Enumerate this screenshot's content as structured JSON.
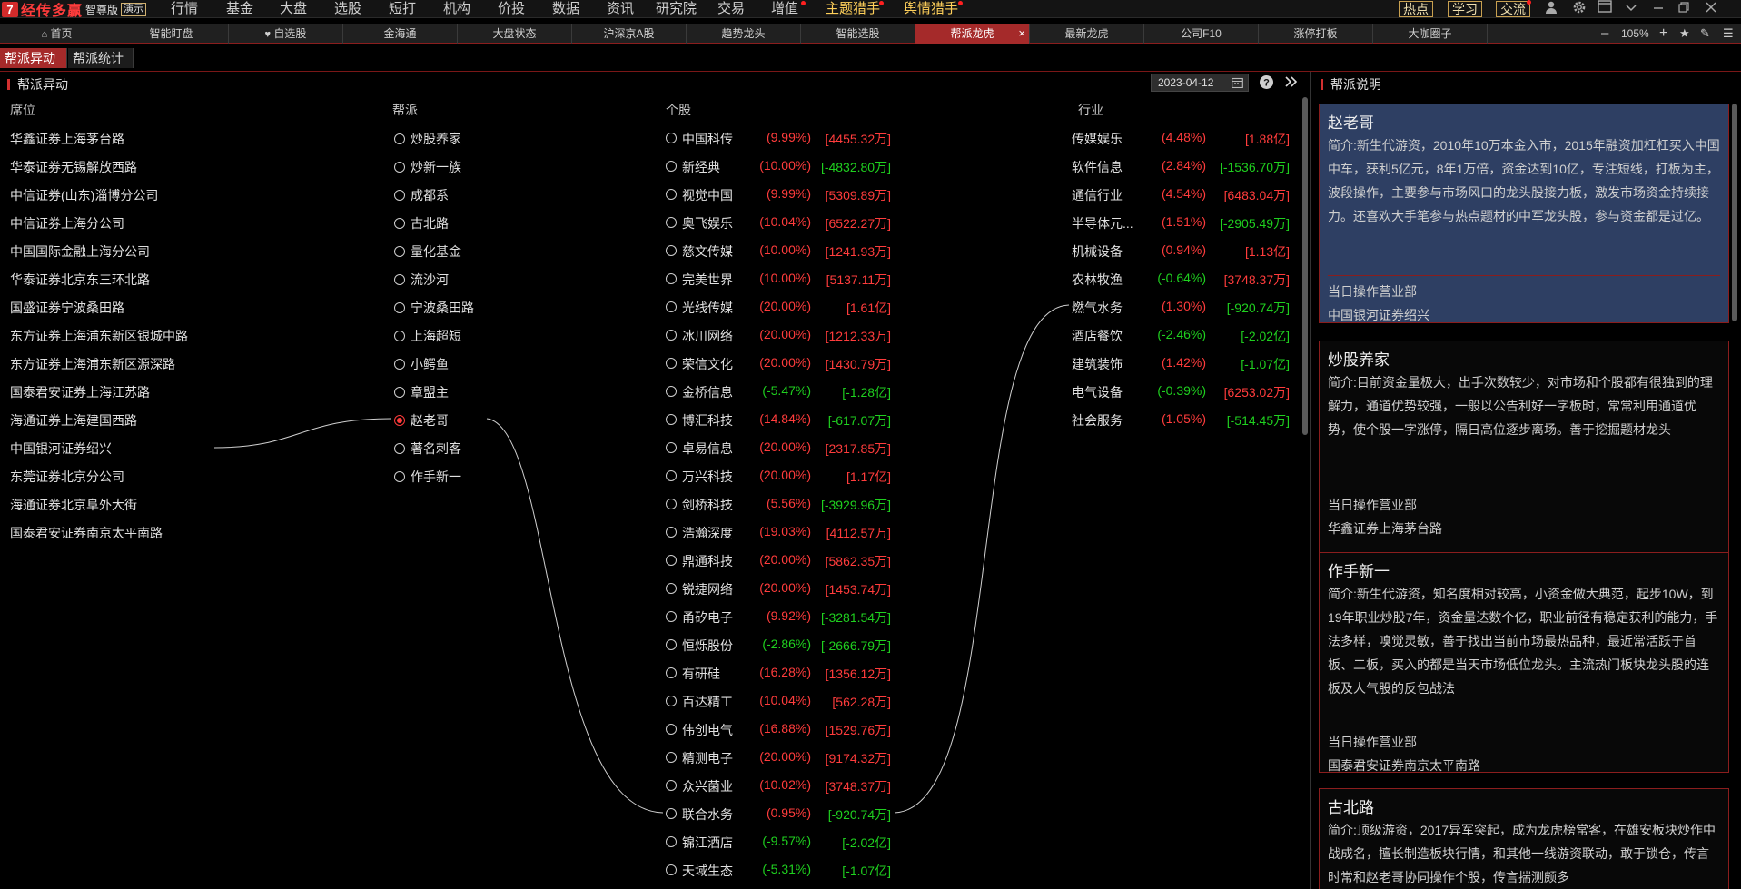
{
  "app": {
    "logo_mark": "7",
    "name": "经传多赢",
    "edition": "智尊版",
    "demo": "演示"
  },
  "menu": [
    "行情",
    "基金",
    "大盘",
    "选股",
    "短打",
    "机构",
    "价投",
    "数据",
    "资讯",
    "研究院",
    "交易",
    "增值",
    "主题猎手",
    "舆情猎手"
  ],
  "top_buttons": [
    "热点",
    "学习",
    "交流"
  ],
  "tabs": [
    "首页",
    "智能盯盘",
    "自选股",
    "金海通",
    "大盘状态",
    "沪深京A股",
    "趋势龙头",
    "智能选股",
    "帮派龙虎",
    "最新龙虎",
    "公司F10",
    "涨停打板",
    "大咖圈子"
  ],
  "tab_close": "×",
  "zoom": "105%",
  "subtabs": [
    "帮派异动",
    "帮派统计"
  ],
  "left_title": "帮派异动",
  "date": "2023-04-12",
  "right_title": "帮派说明",
  "headers": {
    "seat": "席位",
    "gang": "帮派",
    "stock": "个股",
    "industry": "行业"
  },
  "seats": [
    "华鑫证券上海茅台路",
    "华泰证券无锡解放西路",
    "中信证券(山东)淄博分公司",
    "中信证券上海分公司",
    "中国国际金融上海分公司",
    "华泰证券北京东三环北路",
    "国盛证券宁波桑田路",
    "东方证券上海浦东新区银城中路",
    "东方证券上海浦东新区源深路",
    "国泰君安证券上海江苏路",
    "海通证券上海建国西路",
    "中国银河证券绍兴",
    "东莞证券北京分公司",
    "海通证券北京阜外大街",
    "国泰君安证券南京太平南路"
  ],
  "gangs": [
    "炒股养家",
    "炒新一族",
    "成都系",
    "古北路",
    "量化基金",
    "流沙河",
    "宁波桑田路",
    "上海超短",
    "小鳄鱼",
    "章盟主",
    "赵老哥",
    "著名刺客",
    "作手新一"
  ],
  "selected_gang": "赵老哥",
  "stocks": [
    {
      "name": "中国科传",
      "pct": "(9.99%)",
      "amt": "[4455.32万]",
      "pc": "red",
      "ac": "red"
    },
    {
      "name": "新经典",
      "pct": "(10.00%)",
      "amt": "[-4832.80万]",
      "pc": "red",
      "ac": "green"
    },
    {
      "name": "视觉中国",
      "pct": "(9.99%)",
      "amt": "[5309.89万]",
      "pc": "red",
      "ac": "red"
    },
    {
      "name": "奥飞娱乐",
      "pct": "(10.04%)",
      "amt": "[6522.27万]",
      "pc": "red",
      "ac": "red"
    },
    {
      "name": "慈文传媒",
      "pct": "(10.00%)",
      "amt": "[1241.93万]",
      "pc": "red",
      "ac": "red"
    },
    {
      "name": "完美世界",
      "pct": "(10.00%)",
      "amt": "[5137.11万]",
      "pc": "red",
      "ac": "red"
    },
    {
      "name": "光线传媒",
      "pct": "(20.00%)",
      "amt": "[1.61亿]",
      "pc": "red",
      "ac": "red"
    },
    {
      "name": "冰川网络",
      "pct": "(20.00%)",
      "amt": "[1212.33万]",
      "pc": "red",
      "ac": "red"
    },
    {
      "name": "荣信文化",
      "pct": "(20.00%)",
      "amt": "[1430.79万]",
      "pc": "red",
      "ac": "red"
    },
    {
      "name": "金桥信息",
      "pct": "(-5.47%)",
      "amt": "[-1.28亿]",
      "pc": "green",
      "ac": "green"
    },
    {
      "name": "博汇科技",
      "pct": "(14.84%)",
      "amt": "[-617.07万]",
      "pc": "red",
      "ac": "green"
    },
    {
      "name": "卓易信息",
      "pct": "(20.00%)",
      "amt": "[2317.85万]",
      "pc": "red",
      "ac": "red"
    },
    {
      "name": "万兴科技",
      "pct": "(20.00%)",
      "amt": "[1.17亿]",
      "pc": "red",
      "ac": "red"
    },
    {
      "name": "剑桥科技",
      "pct": "(5.56%)",
      "amt": "[-3929.96万]",
      "pc": "red",
      "ac": "green"
    },
    {
      "name": "浩瀚深度",
      "pct": "(19.03%)",
      "amt": "[4112.57万]",
      "pc": "red",
      "ac": "red"
    },
    {
      "name": "鼎通科技",
      "pct": "(20.00%)",
      "amt": "[5862.35万]",
      "pc": "red",
      "ac": "red"
    },
    {
      "name": "锐捷网络",
      "pct": "(20.00%)",
      "amt": "[1453.74万]",
      "pc": "red",
      "ac": "red"
    },
    {
      "name": "甬矽电子",
      "pct": "(9.92%)",
      "amt": "[-3281.54万]",
      "pc": "red",
      "ac": "green"
    },
    {
      "name": "恒烁股份",
      "pct": "(-2.86%)",
      "amt": "[-2666.79万]",
      "pc": "green",
      "ac": "green"
    },
    {
      "name": "有研硅",
      "pct": "(16.28%)",
      "amt": "[1356.12万]",
      "pc": "red",
      "ac": "red"
    },
    {
      "name": "百达精工",
      "pct": "(10.04%)",
      "amt": "[562.28万]",
      "pc": "red",
      "ac": "red"
    },
    {
      "name": "伟创电气",
      "pct": "(16.88%)",
      "amt": "[1529.76万]",
      "pc": "red",
      "ac": "red"
    },
    {
      "name": "精测电子",
      "pct": "(20.00%)",
      "amt": "[9174.32万]",
      "pc": "red",
      "ac": "red"
    },
    {
      "name": "众兴菌业",
      "pct": "(10.02%)",
      "amt": "[3748.37万]",
      "pc": "red",
      "ac": "red"
    },
    {
      "name": "联合水务",
      "pct": "(0.95%)",
      "amt": "[-920.74万]",
      "pc": "red",
      "ac": "green"
    },
    {
      "name": "锦江酒店",
      "pct": "(-9.57%)",
      "amt": "[-2.02亿]",
      "pc": "green",
      "ac": "green"
    },
    {
      "name": "天域生态",
      "pct": "(-5.31%)",
      "amt": "[-1.07亿]",
      "pc": "green",
      "ac": "green"
    }
  ],
  "industries": [
    {
      "name": "传媒娱乐",
      "pct": "(4.48%)",
      "amt": "[1.88亿]",
      "pc": "red",
      "ac": "red"
    },
    {
      "name": "软件信息",
      "pct": "(2.84%)",
      "amt": "[-1536.70万]",
      "pc": "red",
      "ac": "green"
    },
    {
      "name": "通信行业",
      "pct": "(4.54%)",
      "amt": "[6483.04万]",
      "pc": "red",
      "ac": "red"
    },
    {
      "name": "半导体元...",
      "pct": "(1.51%)",
      "amt": "[-2905.49万]",
      "pc": "red",
      "ac": "green"
    },
    {
      "name": "机械设备",
      "pct": "(0.94%)",
      "amt": "[1.13亿]",
      "pc": "red",
      "ac": "red"
    },
    {
      "name": "农林牧渔",
      "pct": "(-0.64%)",
      "amt": "[3748.37万]",
      "pc": "green",
      "ac": "red"
    },
    {
      "name": "燃气水务",
      "pct": "(1.30%)",
      "amt": "[-920.74万]",
      "pc": "red",
      "ac": "green"
    },
    {
      "name": "酒店餐饮",
      "pct": "(-2.46%)",
      "amt": "[-2.02亿]",
      "pc": "green",
      "ac": "green"
    },
    {
      "name": "建筑装饰",
      "pct": "(1.42%)",
      "amt": "[-1.07亿]",
      "pc": "red",
      "ac": "green"
    },
    {
      "name": "电气设备",
      "pct": "(-0.39%)",
      "amt": "[6253.02万]",
      "pc": "green",
      "ac": "red"
    },
    {
      "name": "社会服务",
      "pct": "(1.05%)",
      "amt": "[-514.45万]",
      "pc": "red",
      "ac": "green"
    }
  ],
  "cards": [
    {
      "name": "赵老哥",
      "desc": "简介:新生代游资，2010年10万本金入市，2015年融资加杠杠买入中国中车，获利5亿元，8年1万倍，资金达到10亿，专注短线，打板为主，波段操作，主要参与市场风口的龙头股接力板，激发市场资金持续接力。还喜欢大手笔参与热点题材的中军龙头股，参与资金都是过亿。",
      "dept_label": "当日操作营业部",
      "dept": "中国银河证券绍兴"
    },
    {
      "name": "炒股养家",
      "desc": "简介:目前资金量极大，出手次数较少，对市场和个股都有很独到的理解力，通道优势较强，一般以公告利好一字板时，常常利用通道优势，使个股一字涨停，隔日高位逐步离场。善于挖掘题材龙头",
      "dept_label": "当日操作营业部",
      "dept": "华鑫证券上海茅台路"
    },
    {
      "name": "作手新一",
      "desc": "简介:新生代游资，知名度相对较高，小资金做大典范，起步10W，到19年职业炒股7年，资金量达数个亿，职业前径有稳定获利的能力，手法多样，嗅觉灵敏，善于找出当前市场最热品种，最近常活跃于首板、二板，买入的都是当天市场低位龙头。主流热门板块龙头股的连板及人气股的反包战法",
      "dept_label": "当日操作营业部",
      "dept": "国泰君安证券南京太平南路"
    },
    {
      "name": "古北路",
      "desc": "简介:顶级游资，2017异军突起，成为龙虎榜常客，在雄安板块炒作中战成名，擅长制造板块行情，和其他一线游资联动，敢于锁仓，传言时常和赵老哥协同操作个股，传言揣测颇多",
      "dept_label": "",
      "dept": ""
    }
  ]
}
